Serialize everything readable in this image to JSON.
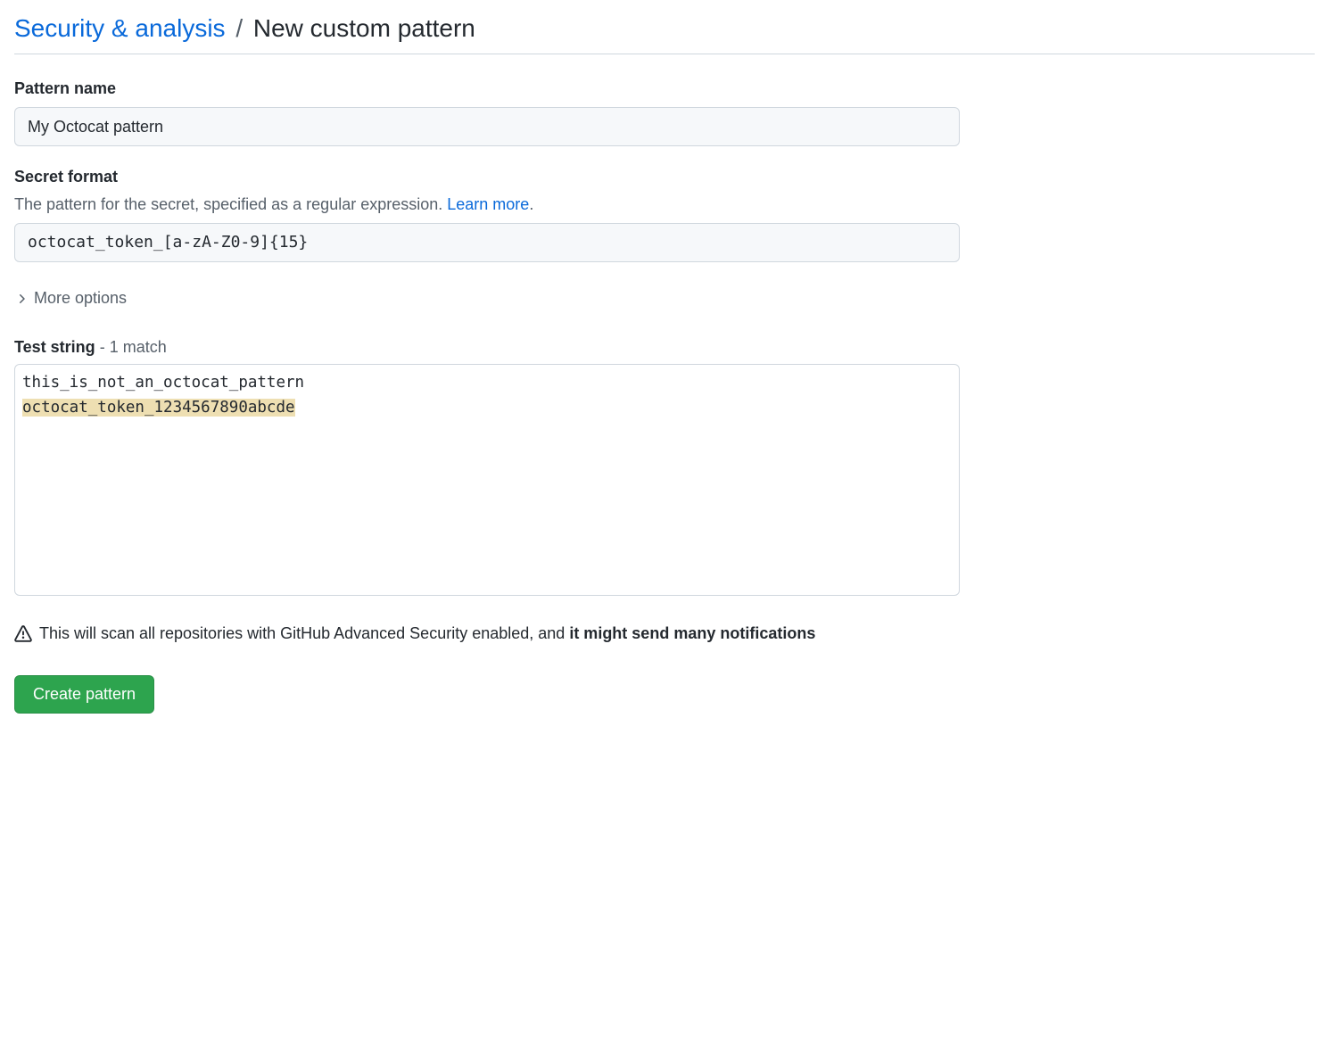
{
  "breadcrumb": {
    "parent": "Security & analysis",
    "separator": "/",
    "current": "New custom pattern"
  },
  "pattern_name": {
    "label": "Pattern name",
    "value": "My Octocat pattern"
  },
  "secret_format": {
    "label": "Secret format",
    "description": "The pattern for the secret, specified as a regular expression. ",
    "learn_more": "Learn more",
    "description_suffix": ".",
    "value": "octocat_token_[a-zA-Z0-9]{15}"
  },
  "more_options": {
    "label": "More options"
  },
  "test_string": {
    "label": "Test string",
    "match_separator": " - ",
    "match_text": "1 match",
    "nonmatch_line": "this_is_not_an_octocat_pattern",
    "match_line": "octocat_token_1234567890abcde"
  },
  "warning": {
    "text_prefix": "This will scan all repositories with GitHub Advanced Security enabled, and ",
    "text_bold": "it might send many notifications"
  },
  "create_button": {
    "label": "Create pattern"
  }
}
